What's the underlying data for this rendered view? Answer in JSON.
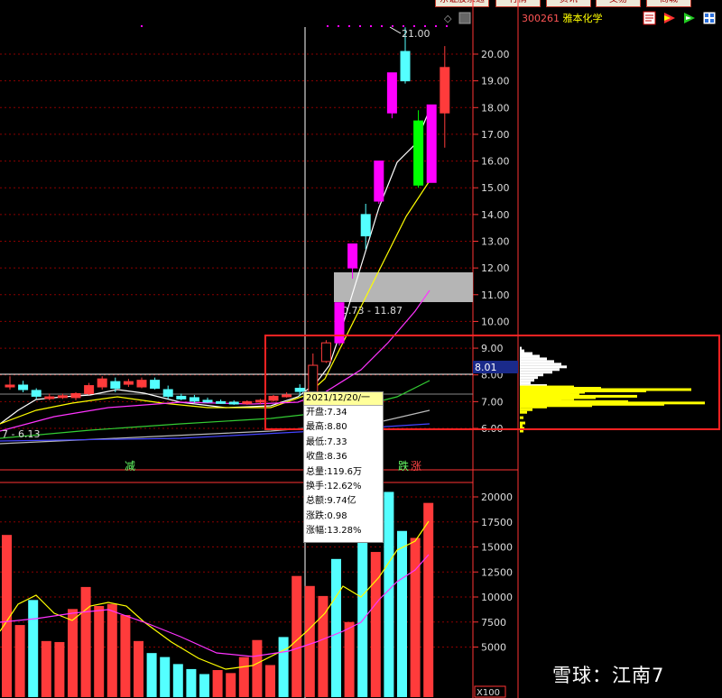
{
  "toolbar": {
    "tabs": [
      "东证股票通",
      "行情",
      "资讯",
      "交易",
      "商城"
    ]
  },
  "stock": {
    "code": "300261",
    "name": "雅本化学"
  },
  "toolbar_icons": [
    "notes-icon",
    "flag-icon",
    "arrow-icon",
    "grid-icon"
  ],
  "watermark": "雪球：江南7",
  "tooltip": {
    "date": "2021/12/20/一",
    "rows": [
      {
        "label": "开盘",
        "value": "7.34"
      },
      {
        "label": "最高",
        "value": "8.80"
      },
      {
        "label": "最低",
        "value": "7.33"
      },
      {
        "label": "收盘",
        "value": "8.36"
      },
      {
        "label": "总量",
        "value": "119.6万"
      },
      {
        "label": "换手",
        "value": "12.62%"
      },
      {
        "label": "总额",
        "value": "9.74亿"
      },
      {
        "label": "涨跌",
        "value": "0.98"
      },
      {
        "label": "涨幅",
        "value": "13.28%"
      }
    ]
  },
  "price_axis": {
    "ticks": [
      "20.00",
      "19.00",
      "18.00",
      "17.00",
      "16.00",
      "15.00",
      "14.00",
      "13.00",
      "12.00",
      "11.00",
      "10.00",
      "9.00",
      "8.00",
      "7.00",
      "6.00"
    ]
  },
  "volume_axis": {
    "ticks": [
      "20000",
      "17500",
      "15000",
      "12500",
      "10000",
      "7500",
      "5000"
    ],
    "unit": "X100"
  },
  "labels": {
    "high_label": "21.00",
    "range_label": "10.73 - 11.87",
    "current_price": "8.01",
    "low_label": "6.13",
    "low_prefix": "7 -",
    "tag_reduce": "减",
    "tag_fall": "跌",
    "tag_rise": "涨"
  },
  "colors": {
    "up": "#ff3b3b",
    "down": "#54ffff",
    "magenta": "#ff00ff",
    "green": "#00ff00",
    "axis": "#ff3333",
    "ma_white": "#ffffff",
    "ma_yellow": "#ffff00",
    "ma_magenta": "#ff33ff",
    "ma_green": "#33cc33",
    "highlight_box": "#ff2222"
  },
  "chart_data": {
    "type": "candlestick",
    "price_range": [
      5.6,
      21.4
    ],
    "volume_range": [
      0,
      21000
    ],
    "candles": [
      {
        "o": 7.55,
        "h": 7.95,
        "l": 7.45,
        "c": 7.62,
        "col": "up"
      },
      {
        "o": 7.62,
        "h": 7.78,
        "l": 7.35,
        "c": 7.45,
        "col": "down"
      },
      {
        "o": 7.42,
        "h": 7.5,
        "l": 7.1,
        "c": 7.2,
        "col": "down"
      },
      {
        "o": 7.15,
        "h": 7.3,
        "l": 7.05,
        "c": 7.18,
        "col": "up"
      },
      {
        "o": 7.2,
        "h": 7.3,
        "l": 7.1,
        "c": 7.22,
        "col": "up"
      },
      {
        "o": 7.15,
        "h": 7.35,
        "l": 7.05,
        "c": 7.3,
        "col": "up"
      },
      {
        "o": 7.3,
        "h": 7.7,
        "l": 7.25,
        "c": 7.6,
        "col": "up"
      },
      {
        "o": 7.55,
        "h": 7.95,
        "l": 7.45,
        "c": 7.85,
        "col": "up"
      },
      {
        "o": 7.5,
        "h": 7.9,
        "l": 7.35,
        "c": 7.75,
        "col": "down"
      },
      {
        "o": 7.65,
        "h": 7.85,
        "l": 7.55,
        "c": 7.75,
        "col": "up"
      },
      {
        "o": 7.8,
        "h": 7.9,
        "l": 7.5,
        "c": 7.55,
        "col": "up"
      },
      {
        "o": 7.8,
        "h": 7.9,
        "l": 7.45,
        "c": 7.5,
        "col": "down"
      },
      {
        "o": 7.45,
        "h": 7.6,
        "l": 7.1,
        "c": 7.2,
        "col": "down"
      },
      {
        "o": 7.2,
        "h": 7.3,
        "l": 7.05,
        "c": 7.1,
        "col": "down"
      },
      {
        "o": 7.15,
        "h": 7.25,
        "l": 6.95,
        "c": 7.02,
        "col": "down"
      },
      {
        "o": 7.05,
        "h": 7.15,
        "l": 6.95,
        "c": 7.0,
        "col": "down"
      },
      {
        "o": 7.0,
        "h": 7.08,
        "l": 6.92,
        "c": 6.98,
        "col": "down"
      },
      {
        "o": 6.98,
        "h": 7.05,
        "l": 6.88,
        "c": 6.95,
        "col": "down"
      },
      {
        "o": 6.95,
        "h": 7.05,
        "l": 6.88,
        "c": 7.0,
        "col": "up"
      },
      {
        "o": 7.0,
        "h": 7.1,
        "l": 6.9,
        "c": 7.05,
        "col": "up"
      },
      {
        "o": 7.05,
        "h": 7.25,
        "l": 7.0,
        "c": 7.2,
        "col": "up"
      },
      {
        "o": 7.2,
        "h": 7.35,
        "l": 7.15,
        "c": 7.25,
        "col": "up"
      },
      {
        "o": 7.5,
        "h": 7.65,
        "l": 7.2,
        "c": 7.38,
        "col": "down"
      },
      {
        "o": 7.34,
        "h": 8.8,
        "l": 7.33,
        "c": 8.36,
        "col": "up"
      },
      {
        "o": 8.5,
        "h": 9.3,
        "l": 8.45,
        "c": 9.2,
        "col": "up"
      },
      {
        "o": 9.2,
        "h": 10.4,
        "l": 9.1,
        "c": 10.7,
        "col": "magenta"
      },
      {
        "o": 12.0,
        "h": 12.4,
        "l": 11.6,
        "c": 12.9,
        "col": "magenta"
      },
      {
        "o": 13.2,
        "h": 14.4,
        "l": 12.7,
        "c": 14.0,
        "col": "down"
      },
      {
        "o": 14.5,
        "h": 16.0,
        "l": 14.4,
        "c": 16.0,
        "col": "magenta"
      },
      {
        "o": 17.8,
        "h": 19.3,
        "l": 17.6,
        "c": 19.3,
        "col": "magenta"
      },
      {
        "o": 19.0,
        "h": 21.0,
        "l": 18.9,
        "c": 20.1,
        "col": "down"
      },
      {
        "o": 17.5,
        "h": 17.9,
        "l": 15.0,
        "c": 15.1,
        "col": "green"
      },
      {
        "o": 15.2,
        "h": 18.1,
        "l": 15.2,
        "c": 18.1,
        "col": "magenta"
      },
      {
        "o": 17.8,
        "h": 20.3,
        "l": 16.5,
        "c": 19.5,
        "col": "up"
      }
    ],
    "volumes": [
      {
        "v": 16200,
        "col": "up"
      },
      {
        "v": 7200,
        "col": "up"
      },
      {
        "v": 9700,
        "col": "down"
      },
      {
        "v": 5600,
        "col": "up"
      },
      {
        "v": 5500,
        "col": "up"
      },
      {
        "v": 8800,
        "col": "up"
      },
      {
        "v": 11000,
        "col": "up"
      },
      {
        "v": 9100,
        "col": "up"
      },
      {
        "v": 9300,
        "col": "up"
      },
      {
        "v": 8200,
        "col": "up"
      },
      {
        "v": 5600,
        "col": "up"
      },
      {
        "v": 4400,
        "col": "down"
      },
      {
        "v": 4000,
        "col": "down"
      },
      {
        "v": 3300,
        "col": "down"
      },
      {
        "v": 2800,
        "col": "down"
      },
      {
        "v": 2300,
        "col": "down"
      },
      {
        "v": 2700,
        "col": "up"
      },
      {
        "v": 2400,
        "col": "up"
      },
      {
        "v": 4000,
        "col": "up"
      },
      {
        "v": 5700,
        "col": "up"
      },
      {
        "v": 3200,
        "col": "up"
      },
      {
        "v": 6000,
        "col": "down"
      },
      {
        "v": 12100,
        "col": "up"
      },
      {
        "v": 11100,
        "col": "up"
      },
      {
        "v": 10100,
        "col": "up"
      },
      {
        "v": 13800,
        "col": "down"
      },
      {
        "v": 7500,
        "col": "up"
      },
      {
        "v": 15900,
        "col": "down"
      },
      {
        "v": 14500,
        "col": "up"
      },
      {
        "v": 20500,
        "col": "down"
      },
      {
        "v": 16600,
        "col": "down"
      },
      {
        "v": 15900,
        "col": "up"
      },
      {
        "v": 19400,
        "col": "up"
      }
    ],
    "volume_profile": [
      {
        "p": 9.0,
        "w": 2
      },
      {
        "p": 8.9,
        "w": 5
      },
      {
        "p": 8.8,
        "w": 14
      },
      {
        "p": 8.7,
        "w": 22
      },
      {
        "p": 8.6,
        "w": 30
      },
      {
        "p": 8.5,
        "w": 38
      },
      {
        "p": 8.4,
        "w": 46
      },
      {
        "p": 8.3,
        "w": 52
      },
      {
        "p": 8.2,
        "w": 44
      },
      {
        "p": 8.1,
        "w": 36
      },
      {
        "p": 8.0,
        "w": 26
      },
      {
        "p": 7.9,
        "w": 20
      },
      {
        "p": 7.8,
        "w": 16
      },
      {
        "p": 7.7,
        "w": 12
      },
      {
        "p": 7.6,
        "w": 30
      },
      {
        "p": 7.55,
        "w": 60
      },
      {
        "p": 7.5,
        "w": 90
      },
      {
        "p": 7.45,
        "w": 190
      },
      {
        "p": 7.4,
        "w": 140
      },
      {
        "p": 7.35,
        "w": 72
      },
      {
        "p": 7.3,
        "w": 56
      },
      {
        "p": 7.25,
        "w": 66
      },
      {
        "p": 7.2,
        "w": 130
      },
      {
        "p": 7.15,
        "w": 84
      },
      {
        "p": 7.1,
        "w": 60
      },
      {
        "p": 7.05,
        "w": 46
      },
      {
        "p": 7.0,
        "w": 120
      },
      {
        "p": 6.95,
        "w": 205
      },
      {
        "p": 6.9,
        "w": 160
      },
      {
        "p": 6.85,
        "w": 80
      },
      {
        "p": 6.8,
        "w": 30
      },
      {
        "p": 6.7,
        "w": 14
      },
      {
        "p": 6.6,
        "w": 8
      },
      {
        "p": 6.4,
        "w": 4
      },
      {
        "p": 6.2,
        "w": 6
      },
      {
        "p": 6.1,
        "w": 3
      },
      {
        "p": 6.0,
        "w": 5
      },
      {
        "p": 5.9,
        "w": 4
      }
    ]
  }
}
